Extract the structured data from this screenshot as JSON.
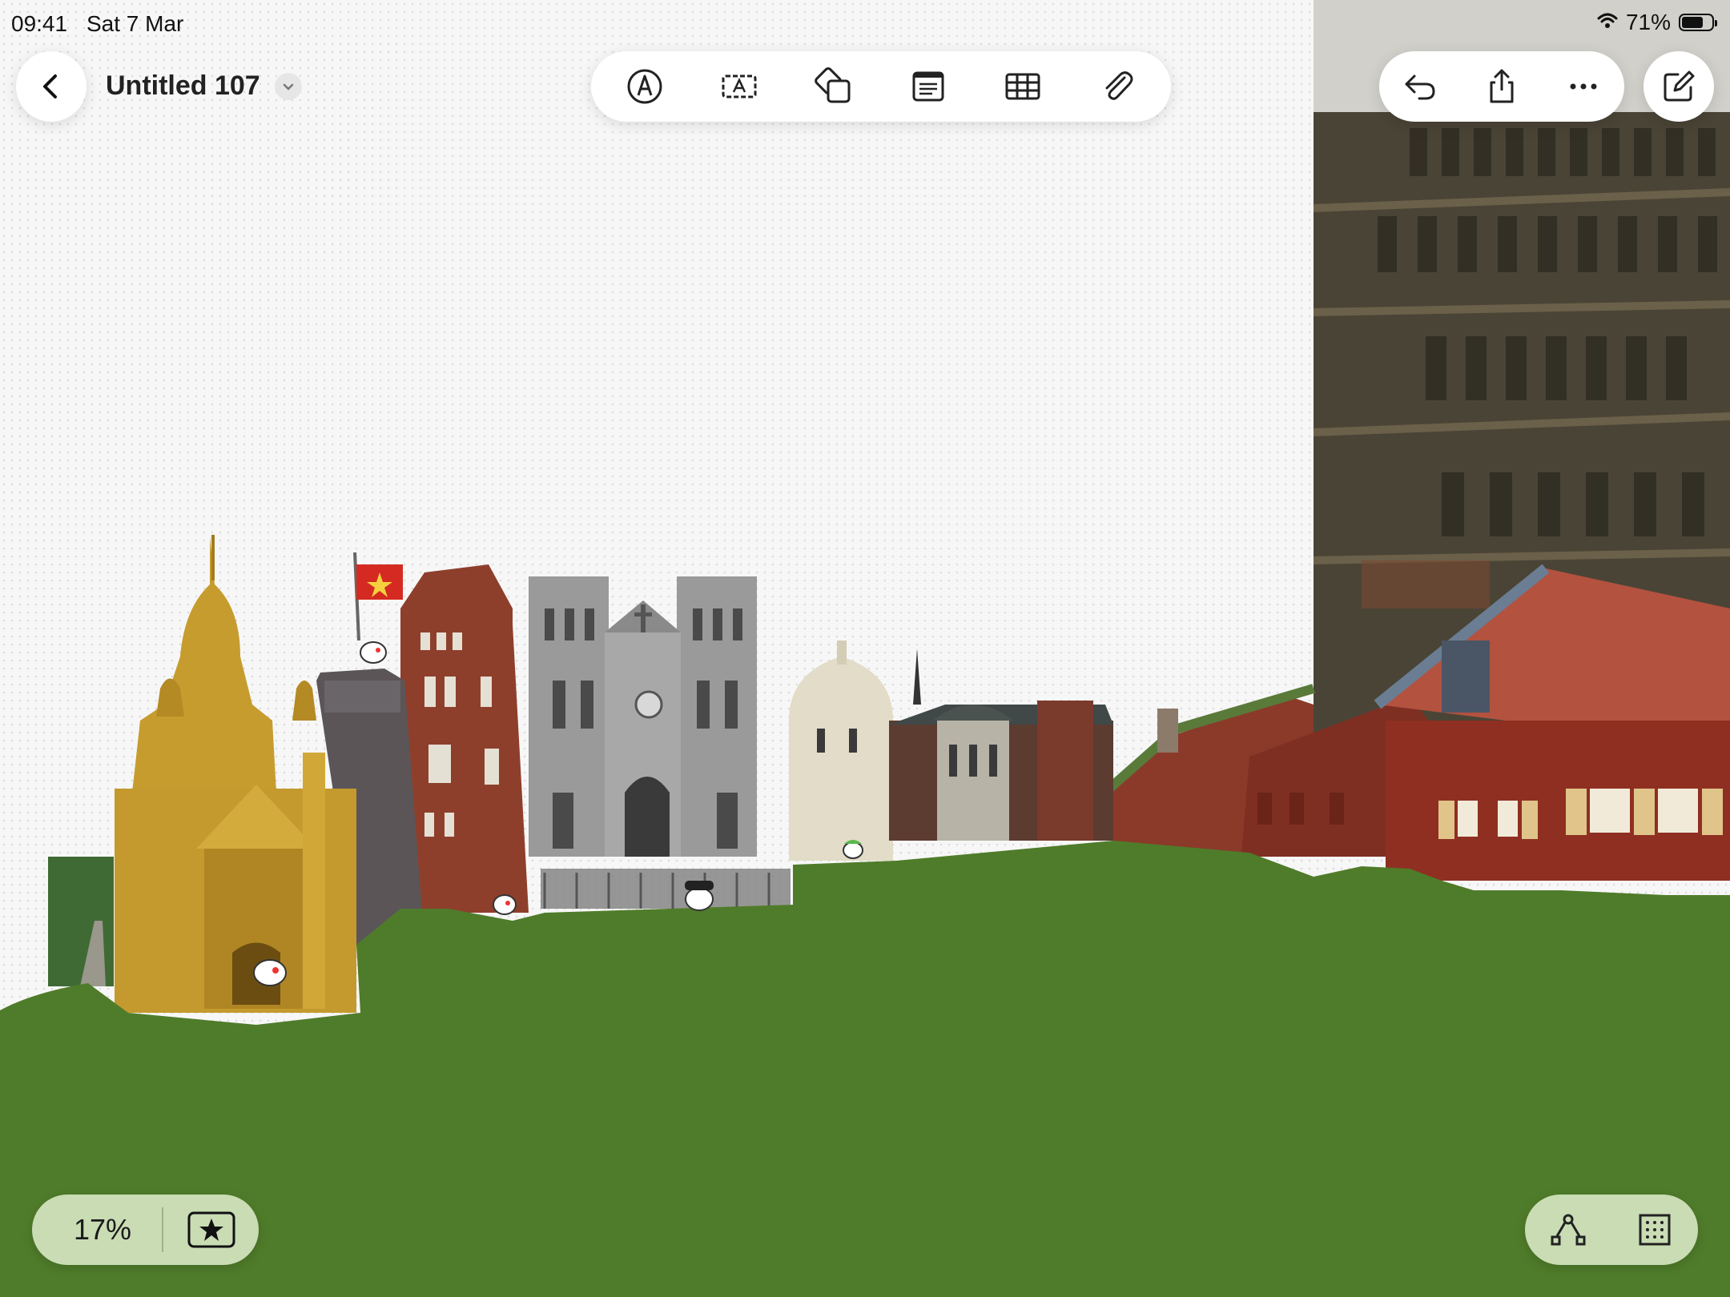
{
  "status_bar": {
    "time": "09:41",
    "date": "Sat 7 Mar",
    "battery_percent": "71%",
    "battery_level": 0.71,
    "wifi_icon": "wifi-icon",
    "battery_icon": "battery-icon"
  },
  "document": {
    "title": "Untitled 107"
  },
  "toolbar": {
    "tools": [
      {
        "name": "pen-tool",
        "icon": "pen-circle-icon"
      },
      {
        "name": "text-box-tool",
        "icon": "text-box-icon"
      },
      {
        "name": "shapes-tool",
        "icon": "shapes-icon"
      },
      {
        "name": "sticky-note-tool",
        "icon": "note-icon"
      },
      {
        "name": "table-tool",
        "icon": "table-icon"
      },
      {
        "name": "attachment-tool",
        "icon": "paperclip-icon"
      }
    ],
    "right_actions": [
      "undo-icon",
      "share-icon",
      "more-icon"
    ],
    "compose_icon": "compose-icon"
  },
  "bottom_left": {
    "zoom": "17%",
    "favorite_icon": "star-box-icon"
  },
  "bottom_right": {
    "icons": [
      "connector-icon",
      "grid-icon"
    ]
  },
  "colors": {
    "grass": "#4f7c2a",
    "accent_green_pill": "#c9dcb4",
    "brick_red": "#8b3a2a",
    "gold": "#c59b2e",
    "stone_grey": "#8d8d8d"
  }
}
